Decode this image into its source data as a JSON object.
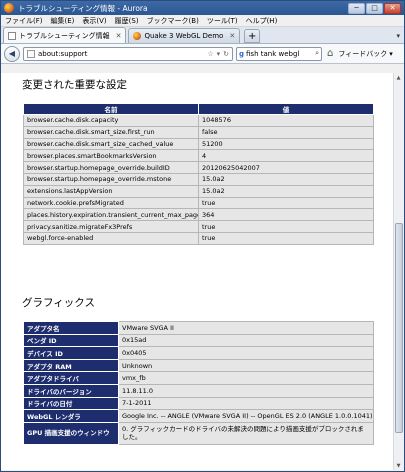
{
  "window": {
    "title": "トラブルシューティング情報 - Aurora",
    "buttons": [
      "─",
      "□",
      "✕"
    ]
  },
  "menu": [
    "ファイル(F)",
    "編集(E)",
    "表示(V)",
    "履歴(S)",
    "ブックマーク(B)",
    "ツール(T)",
    "ヘルプ(H)"
  ],
  "tabs": [
    {
      "label": "トラブルシューティング情報",
      "active": true
    },
    {
      "label": "Quake 3 WebGL Demo",
      "active": false
    }
  ],
  "navbar": {
    "url": "about:support",
    "search_text": "fish tank webgl",
    "feedback": "フィードバック"
  },
  "settings": {
    "heading": "変更された重要な設定",
    "col_name": "名前",
    "col_value": "値",
    "rows": [
      {
        "name": "browser.cache.disk.capacity",
        "value": "1048576"
      },
      {
        "name": "browser.cache.disk.smart_size.first_run",
        "value": "false"
      },
      {
        "name": "browser.cache.disk.smart_size_cached_value",
        "value": "51200"
      },
      {
        "name": "browser.places.smartBookmarksVersion",
        "value": "4"
      },
      {
        "name": "browser.startup.homepage_override.buildID",
        "value": "20120625042007"
      },
      {
        "name": "browser.startup.homepage_override.mstone",
        "value": "15.0a2"
      },
      {
        "name": "extensions.lastAppVersion",
        "value": "15.0a2"
      },
      {
        "name": "network.cookie.prefsMigrated",
        "value": "true"
      },
      {
        "name": "places.history.expiration.transient_current_max_pages",
        "value": "364"
      },
      {
        "name": "privacy.sanitize.migrateFx3Prefs",
        "value": "true"
      },
      {
        "name": "webgl.force-enabled",
        "value": "true"
      }
    ]
  },
  "graphics": {
    "heading": "グラフィックス",
    "rows": [
      {
        "key": "アダプタ名",
        "value": "VMware SVGA II"
      },
      {
        "key": "ベンダ ID",
        "value": "0x15ad"
      },
      {
        "key": "デバイス ID",
        "value": "0x0405"
      },
      {
        "key": "アダプタ RAM",
        "value": "Unknown"
      },
      {
        "key": "アダプタドライバ",
        "value": "vmx_fb"
      },
      {
        "key": "ドライバのバージョン",
        "value": "11.8.11.0"
      },
      {
        "key": "ドライバの日付",
        "value": "7-1-2011"
      },
      {
        "key": "WebGL レンダラ",
        "value": "Google Inc. -- ANGLE (VMware SVGA II) -- OpenGL ES 2.0 (ANGLE 1.0.0.1041)"
      },
      {
        "key": "GPU 描画支援のウィンドウ",
        "value": "0. グラフィックカードのドライバの未解決の問題により描画支援がブロックされました。"
      }
    ]
  }
}
